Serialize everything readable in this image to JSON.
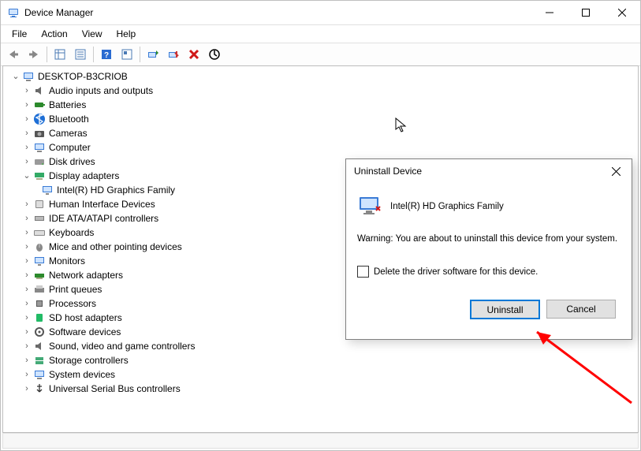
{
  "window": {
    "title": "Device Manager"
  },
  "menu": {
    "file": "File",
    "action": "Action",
    "view": "View",
    "help": "Help"
  },
  "tree": {
    "root": "DESKTOP-B3CRIOB",
    "nodes": {
      "audio": "Audio inputs and outputs",
      "batteries": "Batteries",
      "bluetooth": "Bluetooth",
      "cameras": "Cameras",
      "computer": "Computer",
      "disk": "Disk drives",
      "display": "Display adapters",
      "intel": "Intel(R) HD Graphics Family",
      "hid": "Human Interface Devices",
      "ide": "IDE ATA/ATAPI controllers",
      "keyboards": "Keyboards",
      "mice": "Mice and other pointing devices",
      "monitors": "Monitors",
      "network": "Network adapters",
      "print": "Print queues",
      "processors": "Processors",
      "sdhost": "SD host adapters",
      "software": "Software devices",
      "sound": "Sound, video and game controllers",
      "storage": "Storage controllers",
      "system": "System devices",
      "usb": "Universal Serial Bus controllers"
    }
  },
  "dialog": {
    "title": "Uninstall Device",
    "device": "Intel(R) HD Graphics Family",
    "warning": "Warning: You are about to uninstall this device from your system.",
    "checkbox": "Delete the driver software for this device.",
    "uninstall": "Uninstall",
    "cancel": "Cancel"
  }
}
